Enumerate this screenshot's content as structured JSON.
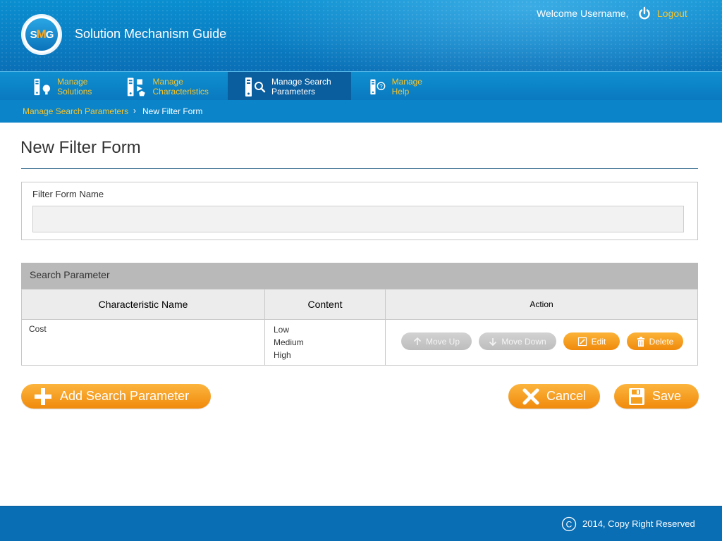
{
  "header": {
    "logo_text_s": "S",
    "logo_text_m": "M",
    "logo_text_g": "G",
    "app_title": "Solution Mechanism Guide",
    "welcome": "Welcome Username,",
    "logout": "Logout"
  },
  "nav": {
    "items": [
      {
        "label_line1": "Manage",
        "label_line2": "Solutions",
        "icon": "solutions-icon",
        "active": false
      },
      {
        "label_line1": "Manage",
        "label_line2": "Characteristics",
        "icon": "characteristics-icon",
        "active": false
      },
      {
        "label_line1": "Manage Search",
        "label_line2": "Parameters",
        "icon": "search-parameters-icon",
        "active": true
      },
      {
        "label_line1": "Manage",
        "label_line2": "Help",
        "icon": "help-icon",
        "active": false
      }
    ]
  },
  "breadcrumb": {
    "link": "Manage Search Parameters",
    "separator": "›",
    "current": "New Filter Form"
  },
  "page": {
    "title": "New Filter Form"
  },
  "form": {
    "label": "Filter Form Name",
    "value": "",
    "placeholder": ""
  },
  "search_parameter": {
    "header": "Search Parameter",
    "columns": [
      "Characteristic Name",
      "Content",
      "Action"
    ],
    "rows": [
      {
        "name": "Cost",
        "content": [
          "Low",
          "Medium",
          "High"
        ],
        "actions": {
          "move_up": "Move Up",
          "move_down": "Move Down",
          "edit": "Edit",
          "delete": "Delete"
        }
      }
    ]
  },
  "buttons": {
    "add_search_parameter": "Add Search Parameter",
    "cancel": "Cancel",
    "save": "Save"
  },
  "footer": {
    "copyright_symbol": "C",
    "copyright": "2014, Copy Right Reserved"
  },
  "colors": {
    "header_blue": "#0a7fc4",
    "accent_orange": "#f08a0c",
    "link_yellow": "#f7c42c",
    "disabled_gray": "#bdbdbd"
  }
}
